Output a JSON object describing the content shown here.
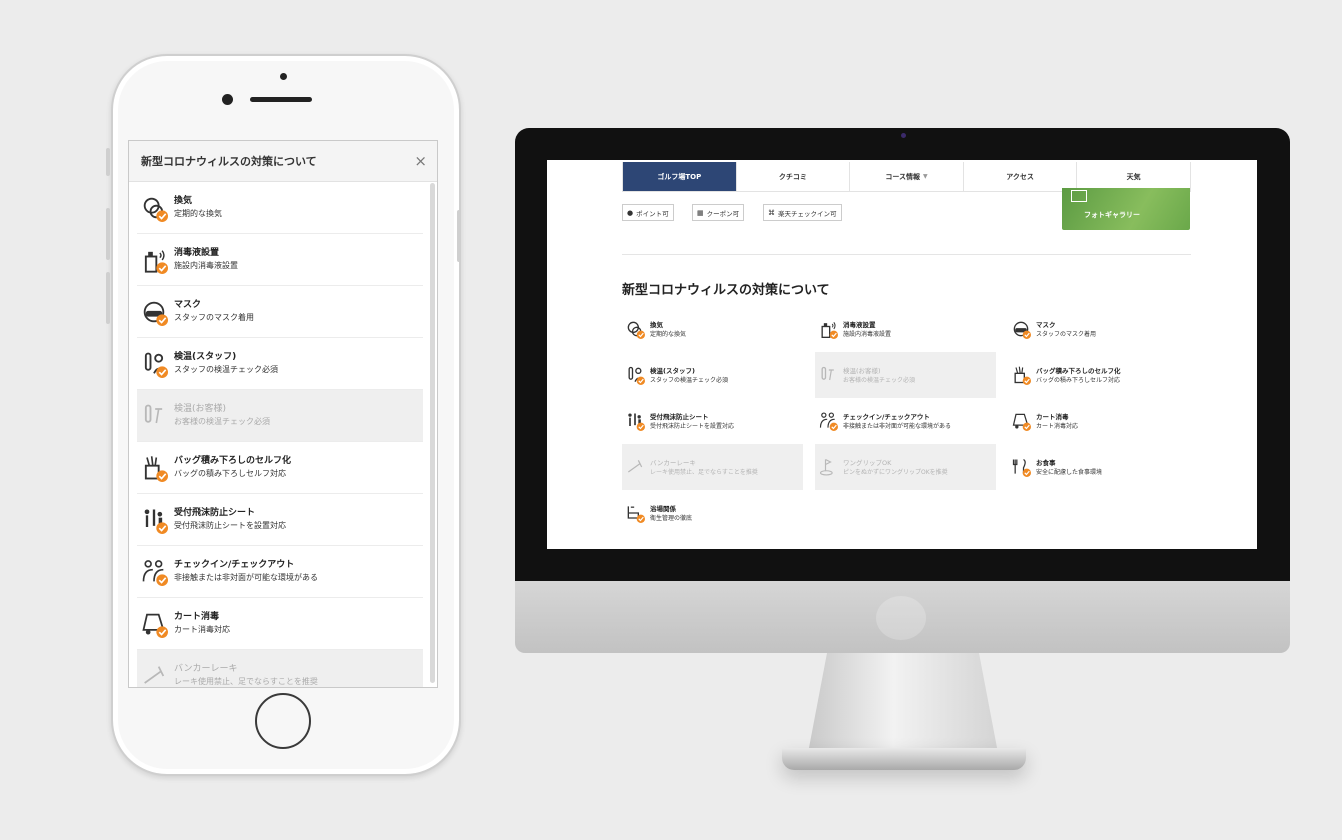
{
  "colors": {
    "accent_orange": "#f08a24",
    "nav_active": "#2d4675",
    "icon_gray": "#333333"
  },
  "mobile": {
    "title": "新型コロナウィルスの対策について",
    "close_icon": "×",
    "items": [
      {
        "title": "換気",
        "desc": "定期的な換気",
        "icon": "ventilation-icon",
        "active": true
      },
      {
        "title": "消毒液設置",
        "desc": "施設内消毒液設置",
        "icon": "sanitizer-icon",
        "active": true
      },
      {
        "title": "マスク",
        "desc": "スタッフのマスク着用",
        "icon": "mask-icon",
        "active": true
      },
      {
        "title": "検温(スタッフ)",
        "desc": "スタッフの検温チェック必須",
        "icon": "thermometer-staff-icon",
        "active": true
      },
      {
        "title": "検温(お客様)",
        "desc": "お客様の検温チェック必須",
        "icon": "thermometer-guest-icon",
        "active": false
      },
      {
        "title": "バッグ積み下ろしのセルフ化",
        "desc": "バッグの積み下ろしセルフ対応",
        "icon": "golf-bag-icon",
        "active": true
      },
      {
        "title": "受付飛沫防止シート",
        "desc": "受付飛沫防止シートを設置対応",
        "icon": "reception-shield-icon",
        "active": true
      },
      {
        "title": "チェックイン/チェックアウト",
        "desc": "非接触または非対面が可能な環境がある",
        "icon": "contactless-icon",
        "active": true
      },
      {
        "title": "カート消毒",
        "desc": "カート消毒対応",
        "icon": "cart-icon",
        "active": true
      },
      {
        "title": "バンカーレーキ",
        "desc": "レーキ使用禁止、足でならすことを推奨",
        "icon": "rake-icon",
        "active": false
      }
    ]
  },
  "desktop": {
    "nav": {
      "tabs": [
        {
          "label": "ゴルフ場TOP",
          "active": true
        },
        {
          "label": "クチコミ",
          "active": false
        },
        {
          "label": "コース情報",
          "active": false,
          "chevron": "▼"
        },
        {
          "label": "アクセス",
          "active": false
        },
        {
          "label": "天気",
          "active": false
        }
      ]
    },
    "pills": [
      {
        "icon": "●",
        "label": "ポイント可"
      },
      {
        "icon": "▦",
        "label": "クーポン可"
      },
      {
        "icon": "⌘",
        "label": "楽天チェックイン可"
      }
    ],
    "photo_gallery_label": "フォトギャラリー",
    "section_title": "新型コロナウィルスの対策について",
    "items": [
      {
        "title": "換気",
        "desc": "定期的な換気",
        "icon": "ventilation-icon",
        "active": true
      },
      {
        "title": "消毒液設置",
        "desc": "施設内消毒液設置",
        "icon": "sanitizer-icon",
        "active": true
      },
      {
        "title": "マスク",
        "desc": "スタッフのマスク着用",
        "icon": "mask-icon",
        "active": true
      },
      {
        "title": "検温(スタッフ)",
        "desc": "スタッフの検温チェック必須",
        "icon": "thermometer-staff-icon",
        "active": true
      },
      {
        "title": "検温(お客様)",
        "desc": "お客様の検温チェック必須",
        "icon": "thermometer-guest-icon",
        "active": false
      },
      {
        "title": "バッグ積み下ろしのセルフ化",
        "desc": "バッグの積み下ろしセルフ対応",
        "icon": "golf-bag-icon",
        "active": true
      },
      {
        "title": "受付飛沫防止シート",
        "desc": "受付飛沫防止シートを設置対応",
        "icon": "reception-shield-icon",
        "active": true
      },
      {
        "title": "チェックイン/チェックアウト",
        "desc": "非接触または非対面が可能な環境がある",
        "icon": "contactless-icon",
        "active": true
      },
      {
        "title": "カート消毒",
        "desc": "カート消毒対応",
        "icon": "cart-icon",
        "active": true
      },
      {
        "title": "バンカーレーキ",
        "desc": "レーキ使用禁止、足でならすことを推奨",
        "icon": "rake-icon",
        "active": false
      },
      {
        "title": "ワングリップOK",
        "desc": "ピンをぬかずにワングリップOKを推奨",
        "icon": "flag-pin-icon",
        "active": false
      },
      {
        "title": "お食事",
        "desc": "安全に配慮した食事環境",
        "icon": "meal-icon",
        "active": true
      },
      {
        "title": "浴場関係",
        "desc": "衛生管理の徹底",
        "icon": "bath-icon",
        "active": true
      }
    ]
  }
}
